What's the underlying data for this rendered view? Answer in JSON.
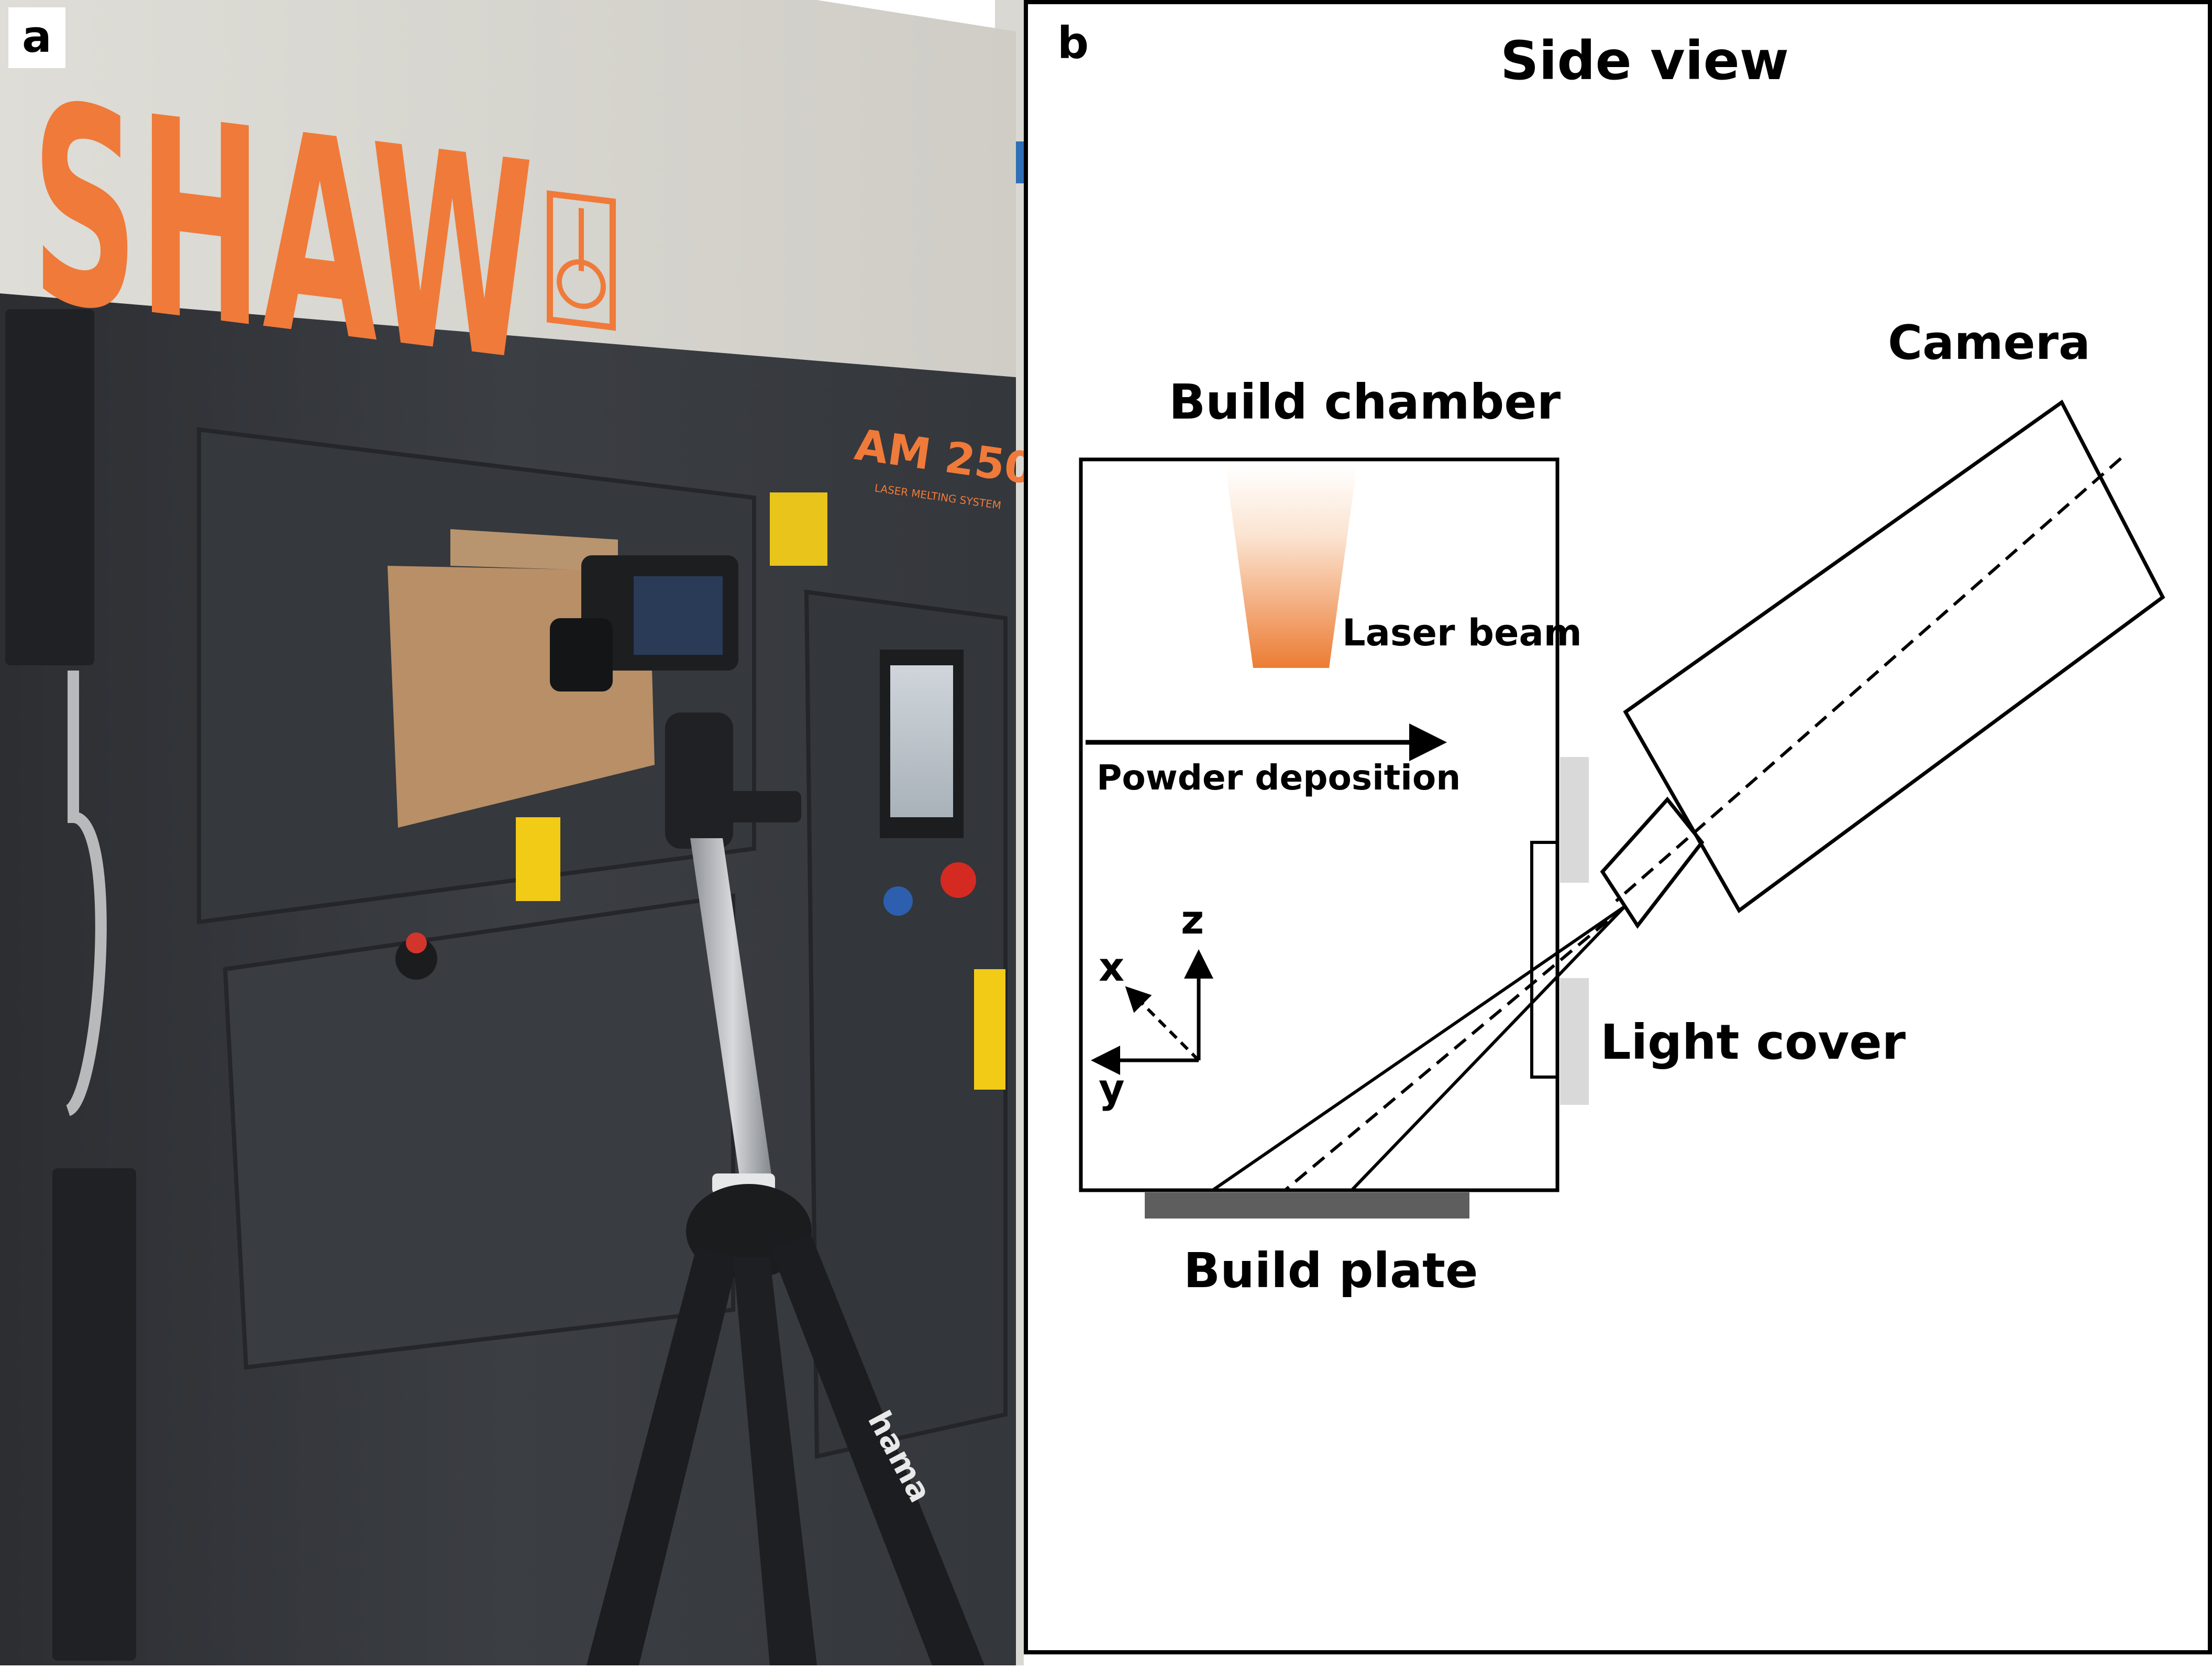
{
  "panel_a": {
    "letter": "a",
    "machine_brand": "SHAW",
    "machine_model": "AM 250",
    "machine_subtitle": "LASER MELTING SYSTEM",
    "tripod_brand": "hama"
  },
  "panel_b": {
    "letter": "b",
    "title": "Side view",
    "labels": {
      "camera": "Camera",
      "build_chamber": "Build chamber",
      "laser_beam": "Laser beam",
      "powder_deposition": "Powder deposition",
      "light_cover": "Light cover",
      "build_plate": "Build plate"
    },
    "axes": {
      "z": "z",
      "x": "x",
      "y": "y"
    }
  },
  "colors": {
    "brand_orange": "#f07a3a",
    "laser_orange": "#ec7c34",
    "machine_dark": "#3a3d42",
    "build_plate": "#5e5e5e",
    "light_cover_gray": "#d9d9d9"
  }
}
